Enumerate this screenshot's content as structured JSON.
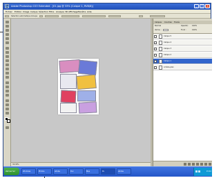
{
  "window": {
    "title": "Adobe Photoshop CS3 Extended - [01.jpg @ 33% (Calque 1, RVB/8)]",
    "app_icon": "Ps",
    "controls": {
      "minimize": "_",
      "maximize": "□",
      "close": "x"
    }
  },
  "menu": [
    "Fichier",
    "Edition",
    "Image",
    "Calque",
    "Sélection",
    "Filtre",
    "Analyse",
    "3D",
    "Affichage",
    "Fenêtre",
    "Aide"
  ],
  "options_bar": {
    "mode_label": "Sélection automatique",
    "mode_value": "Groupe"
  },
  "status": {
    "zoom": "33,33%"
  },
  "panel": {
    "tabs": [
      "Calques",
      "Couches",
      "Tracés"
    ],
    "blend_mode": "Normal",
    "opacity_label": "Opacité :",
    "opacity_value": "100%",
    "lock_label": "Verrou :",
    "fill_label": "Fond :",
    "fill_value": "100%",
    "layers": [
      {
        "name": "Calque 5",
        "selected": false
      },
      {
        "name": "Calque 4",
        "selected": false
      },
      {
        "name": "Calque 3",
        "selected": false
      },
      {
        "name": "Calque 2",
        "selected": false
      },
      {
        "name": "Calque 1",
        "selected": true
      },
      {
        "name": "Arrière-plan",
        "selected": false
      }
    ]
  },
  "taskbar": {
    "start_label": "démarrer",
    "buttons": [
      "Windows",
      "Photos",
      "Adobe",
      "Doc",
      "Mes",
      "Ps",
      "Adobe"
    ],
    "clock": "15:42"
  }
}
